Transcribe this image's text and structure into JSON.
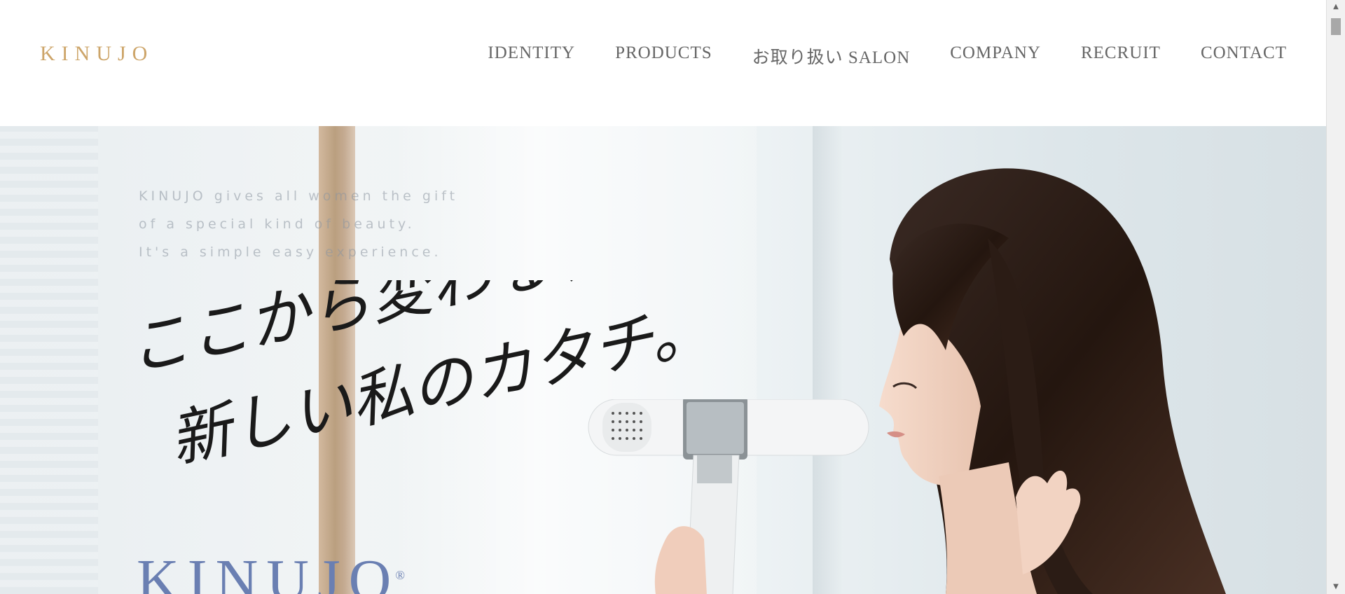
{
  "header": {
    "logo": "KINUJO",
    "nav": [
      "IDENTITY",
      "PRODUCTS",
      "お取り扱い SALON",
      "COMPANY",
      "RECRUIT",
      "CONTACT"
    ]
  },
  "hero": {
    "tagline": [
      "KINUJO gives all women the gift",
      "of a special kind of beauty.",
      "It's a simple easy experience."
    ],
    "handwriting": [
      "ここから変わる、",
      "新しい私のカタチ。"
    ],
    "brand": "KINUJO",
    "brand_mark": "®"
  },
  "colors": {
    "logo": "#cda56a",
    "nav": "#666666",
    "brand": "#6a7fb2"
  },
  "icons": {
    "scroll_up": "triangle-up-icon",
    "scroll_down": "triangle-down-icon"
  }
}
